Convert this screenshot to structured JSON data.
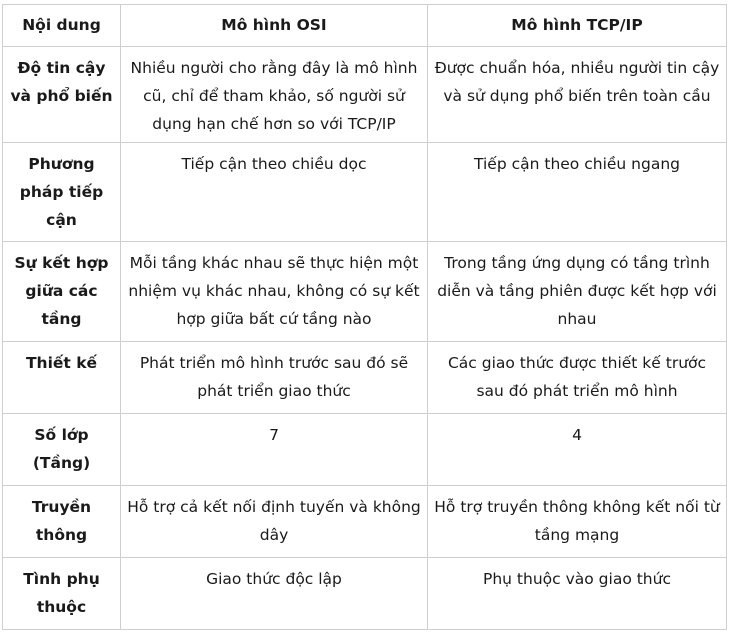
{
  "table": {
    "headers": [
      "Nội dung",
      "Mô hình OSI",
      "Mô hình TCP/IP"
    ],
    "rows": [
      {
        "label": "Độ tin cậy và phổ biến",
        "osi": "Nhiều người cho rằng đây là mô hình cũ, chỉ để tham khảo, số người sử dụng hạn chế hơn so với TCP/IP",
        "tcpip": "Được chuẩn hóa, nhiều người tin cậy và sử dụng phổ biến trên toàn cầu"
      },
      {
        "label": "Phương pháp tiếp cận",
        "osi": "Tiếp cận theo chiều dọc",
        "tcpip": "Tiếp cận theo chiều ngang"
      },
      {
        "label": "Sự kết hợp giữa các tầng",
        "osi": "Mỗi tầng khác nhau sẽ thực hiện một nhiệm vụ khác nhau, không có sự kết hợp giữa bất cứ tầng nào",
        "tcpip": "Trong tầng ứng dụng có tầng trình diễn và tầng phiên được kết hợp với nhau"
      },
      {
        "label": "Thiết kế",
        "osi": "Phát triển mô hình trước sau đó sẽ phát triển giao thức",
        "tcpip": "Các giao thức được thiết kế trước sau đó phát triển mô hình"
      },
      {
        "label": "Số lớp (Tầng)",
        "osi": "7",
        "tcpip": "4"
      },
      {
        "label": "Truyền thông",
        "osi": "Hỗ trợ cả kết nối định tuyến và không dây",
        "tcpip": "Hỗ trợ truyền thông không kết nối từ tầng mạng"
      },
      {
        "label": "Tình phụ thuộc",
        "osi": "Giao thức độc lập",
        "tcpip": "Phụ thuộc vào giao thức"
      }
    ]
  }
}
